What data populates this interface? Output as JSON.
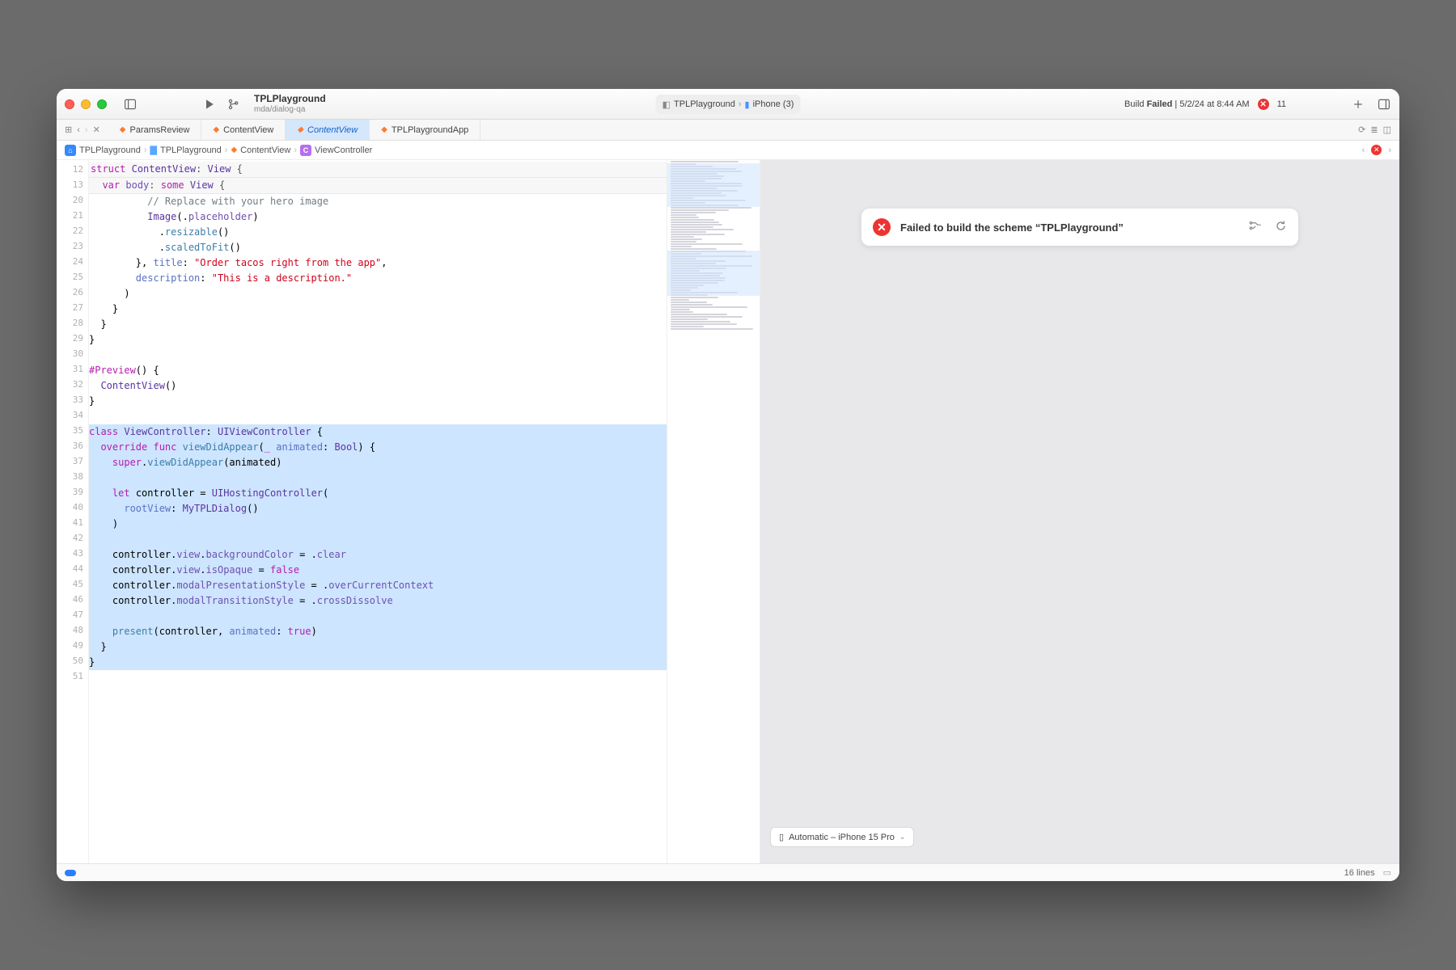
{
  "titlebar": {
    "project": "TPLPlayground",
    "branch": "mda/dialog-qa",
    "scheme_app": "TPLPlayground",
    "scheme_device": "iPhone (3)",
    "build_status_prefix": "Build ",
    "build_status_bold": "Failed",
    "build_status_suffix": " | 5/2/24 at 8:44 AM",
    "error_count": "11"
  },
  "tabs": [
    {
      "label": "ParamsReview"
    },
    {
      "label": "ContentView"
    },
    {
      "label": "ContentView",
      "active": true
    },
    {
      "label": "TPLPlaygroundApp"
    }
  ],
  "tabbar_controls": {
    "grid": "⊞"
  },
  "breadcrumb": {
    "app": "TPLPlayground",
    "folder": "TPLPlayground",
    "file": "ContentView",
    "symbol": "ViewController"
  },
  "editor": {
    "sticky": [
      {
        "n": "12",
        "html": "<span class='kw'>struct</span> <span class='type'>ContentView</span>: <span class='type'>View</span> {"
      },
      {
        "n": "13",
        "html": "  <span class='kw'>var</span> <span class='prop'>body</span>: <span class='kw'>some</span> <span class='type'>View</span> {"
      }
    ],
    "lines": [
      {
        "n": "20",
        "html": "          <span class='cm'>// Replace with your hero image</span>"
      },
      {
        "n": "21",
        "html": "          <span class='type'>Image</span>(.<span class='prop'>placeholder</span>)"
      },
      {
        "n": "22",
        "html": "            .<span class='func'>resizable</span>()"
      },
      {
        "n": "23",
        "html": "            .<span class='func'>scaledToFit</span>()"
      },
      {
        "n": "24",
        "html": "        }, <span class='arg'>title</span>: <span class='str'>\"Order tacos right from the app\"</span>,"
      },
      {
        "n": "25",
        "html": "        <span class='arg'>description</span>: <span class='str'>\"This is a description.\"</span>"
      },
      {
        "n": "26",
        "html": "      )"
      },
      {
        "n": "27",
        "html": "    }"
      },
      {
        "n": "28",
        "html": "  }"
      },
      {
        "n": "29",
        "html": "}"
      },
      {
        "n": "30",
        "html": ""
      },
      {
        "n": "31",
        "html": "<span class='kw'>#Preview</span>() {"
      },
      {
        "n": "32",
        "html": "  <span class='type'>ContentView</span>()"
      },
      {
        "n": "33",
        "html": "}"
      },
      {
        "n": "34",
        "html": ""
      },
      {
        "n": "35",
        "hl": true,
        "html": "<span class='kw'>class</span> <span class='type'>ViewController</span>: <span class='type'>UIViewController</span> {"
      },
      {
        "n": "36",
        "hl": true,
        "html": "  <span class='kw'>override</span> <span class='kw'>func</span> <span class='func'>viewDidAppear</span>(<span class='kw'>_</span> <span class='arg'>animated</span>: <span class='type'>Bool</span>) {"
      },
      {
        "n": "37",
        "hl": true,
        "html": "    <span class='kw'>super</span>.<span class='func'>viewDidAppear</span>(animated)"
      },
      {
        "n": "38",
        "hl": true,
        "html": ""
      },
      {
        "n": "39",
        "hl": true,
        "html": "    <span class='kw'>let</span> controller = <span class='type'>UIHostingController</span>("
      },
      {
        "n": "40",
        "hl": true,
        "html": "      <span class='arg'>rootView</span>: <span class='type'>MyTPLDialog</span>()"
      },
      {
        "n": "41",
        "hl": true,
        "html": "    )"
      },
      {
        "n": "42",
        "hl": true,
        "html": ""
      },
      {
        "n": "43",
        "hl": true,
        "html": "    controller.<span class='prop'>view</span>.<span class='prop'>backgroundColor</span> = .<span class='prop'>clear</span>"
      },
      {
        "n": "44",
        "hl": true,
        "html": "    controller.<span class='prop'>view</span>.<span class='prop'>isOpaque</span> = <span class='kw'>false</span>"
      },
      {
        "n": "45",
        "hl": true,
        "html": "    controller.<span class='prop'>modalPresentationStyle</span> = .<span class='prop'>overCurrentContext</span>"
      },
      {
        "n": "46",
        "hl": true,
        "html": "    controller.<span class='prop'>modalTransitionStyle</span> = .<span class='prop'>crossDissolve</span>"
      },
      {
        "n": "47",
        "hl": true,
        "html": ""
      },
      {
        "n": "48",
        "hl": true,
        "html": "    <span class='func'>present</span>(controller, <span class='arg'>animated</span>: <span class='kw'>true</span>)"
      },
      {
        "n": "49",
        "hl": true,
        "html": "  }"
      },
      {
        "n": "50",
        "hl": true,
        "html": "}"
      },
      {
        "n": "51",
        "html": ""
      }
    ]
  },
  "preview": {
    "error": "Failed to build the scheme “TPLPlayground”",
    "device": "Automatic – iPhone 15 Pro"
  },
  "statusbar": {
    "lines": "16 lines"
  }
}
